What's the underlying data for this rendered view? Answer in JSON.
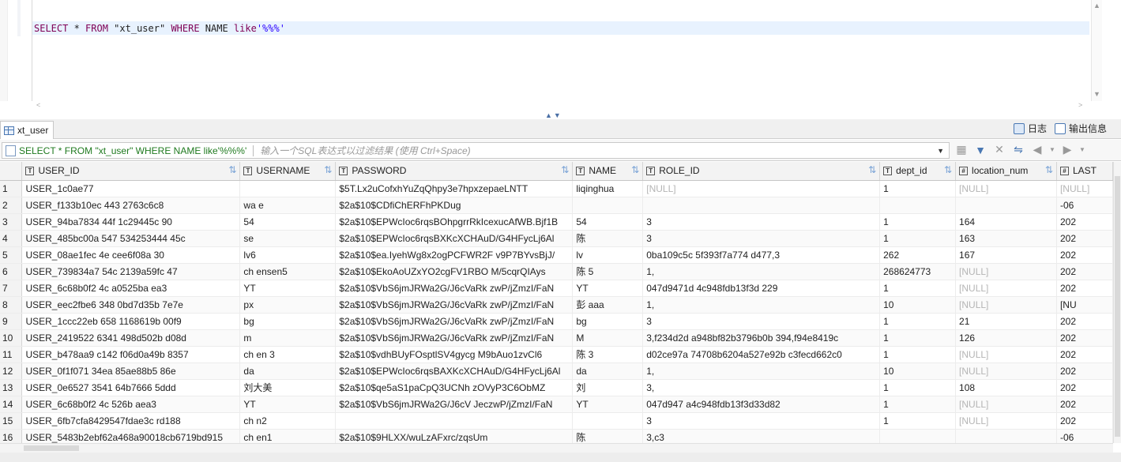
{
  "editor": {
    "sql_parts": [
      {
        "t": "SELECT",
        "c": "kw"
      },
      {
        "t": " * ",
        "c": ""
      },
      {
        "t": "FROM",
        "c": "kw"
      },
      {
        "t": " \"xt_user\" ",
        "c": ""
      },
      {
        "t": "WHERE",
        "c": "kw"
      },
      {
        "t": " NAME ",
        "c": ""
      },
      {
        "t": "like",
        "c": "kw"
      },
      {
        "t": "'%%%'",
        "c": "str"
      }
    ]
  },
  "result": {
    "tab_label": "xt_user",
    "log_label": "日志",
    "output_label": "输出信息",
    "filter_sql": "SELECT * FROM \"xt_user\" WHERE NAME like'%%%'",
    "filter_placeholder": "输入一个SQL表达式以过滤结果 (使用 Ctrl+Space)"
  },
  "grid": {
    "columns": [
      "USER_ID",
      "USERNAME",
      "PASSWORD",
      "NAME",
      "ROLE_ID",
      "dept_id",
      "location_num",
      "LAST"
    ],
    "rows": [
      [
        "1",
        "USER_1c0ae77",
        "",
        "$5T.Lx2uCofxhYuZqQhpy3e7hpxzepaeLNTT",
        "liqinghua",
        "[NULL]",
        "1",
        "[NULL]",
        "[NULL]"
      ],
      [
        "2",
        "USER_f133b10ec  443   2763c6c8",
        "wa    e",
        "$2a$10$CDfiChERFhPKDug",
        "",
        "",
        "",
        "",
        "-06"
      ],
      [
        "3",
        "USER_94ba7834  44f  1c29445c   90",
        "54",
        "$2a$10$EPWcIoc6rqsBOhpgrrRkIcexucAfWB.Bjf1B",
        "54",
        "3",
        "1",
        "164",
        "202"
      ],
      [
        "4",
        "USER_485bc00a  547  534253444  45c",
        "se",
        "$2a$10$EPWcIoc6rqsBXKcXCHAuD/G4HFycLj6Al",
        "陈",
        "3",
        "1",
        "163",
        "202"
      ],
      [
        "5",
        "USER_08ae1fec  4e  cee6f08a  30",
        "lv6",
        "$2a$10$ea.IyehWg8x2ogPCFWR2F  v9P7BYvsBjJ/",
        "lv",
        "0ba109c5c  5f393f7a774  d477,3",
        "262",
        "167",
        "202"
      ],
      [
        "6",
        "USER_739834a7  54c  2139a59fc  47",
        "ch    ensen5",
        "$2a$10$EkoAoUZxYO2cgFV1RBO  M/5cqrQIAys",
        "陈    5",
        "1,",
        "268624773",
        "[NULL]",
        "202"
      ],
      [
        "7",
        "USER_6c68b0f2  4c  a0525ba  ea3",
        "YT",
        "$2a$10$VbS6jmJRWa2G/J6cVaRk  zwP/jZmzI/FaN",
        "YT",
        "047d9471d  4c948fdb13f3d  229",
        "1",
        "[NULL]",
        "202"
      ],
      [
        "8",
        "USER_eec2fbe6  348  0bd7d35b  7e7e",
        "px",
        "$2a$10$VbS6jmJRWa2G/J6cVaRk  zwP/jZmzI/FaN",
        "彭     aaa",
        "1,",
        "10",
        "[NULL]",
        "[NU"
      ],
      [
        "9",
        "USER_1ccc22eb  658  1168619b  00f9",
        "bg",
        "$2a$10$VbS6jmJRWa2G/J6cVaRk  zwP/jZmzI/FaN",
        "bg",
        "3",
        "1",
        "21",
        "202"
      ],
      [
        "10",
        "USER_2419522  6341  498d502b  d08d",
        "m",
        "$2a$10$VbS6jmJRWa2G/J6cVaRk  zwP/jZmzI/FaN",
        "M",
        "3,f234d2d  a948bf82b3796b0b  394,f94e8419c",
        "1",
        "126",
        "202"
      ],
      [
        "11",
        "USER_b478aa9  c142  f06d0a49b  8357",
        "ch    en    3",
        "$2a$10$vdhBUyFOsptlSV4gycg  M9bAuo1zvCl6",
        "陈    3",
        "d02ce97a  74708b6204a527e92b  c3fecd662c0",
        "1",
        "[NULL]",
        "202"
      ],
      [
        "12",
        "USER_0f1f071  34ea  85ae88b5  86e",
        "da",
        "$2a$10$EPWcIoc6rqsBAXKcXCHAuD/G4HFycLj6Al",
        "da",
        "1,",
        "10",
        "[NULL]",
        "202"
      ],
      [
        "13",
        "USER_0e6527  3541  64b7666  5ddd",
        "刘大美",
        "$2a$10$qe5aS1paCpQ3UCNh  zOVyP3C6ObMZ",
        "刘",
        "3,",
        "1",
        "108",
        "202"
      ],
      [
        "14",
        "USER_6c68b0f2  4c  526b  aea3",
        "YT",
        "$2a$10$VbS6jmJRWa2G/J6cV  JeczwP/jZmzI/FaN",
        "YT",
        "047d947  a4c948fdb13f3d33d82",
        "1",
        "[NULL]",
        "202"
      ],
      [
        "15",
        "USER_6fb7cfa8429547fdae3c  rd188",
        "ch    n2",
        "",
        "",
        "3",
        "1",
        "[NULL]",
        "202"
      ],
      [
        "16",
        "USER_5483b2ebf62a468a90018cb6719bd915",
        "ch    en1",
        "$2a$10$9HLXX/wuLzAFxrc/zqsUm",
        "陈",
        "3,c3",
        "",
        "",
        "-06"
      ]
    ]
  }
}
